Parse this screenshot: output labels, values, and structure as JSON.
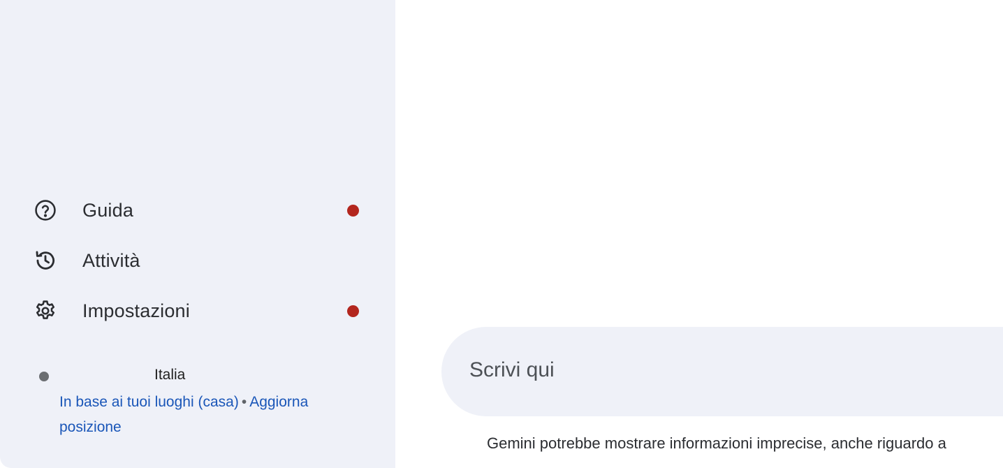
{
  "sidebar": {
    "items": [
      {
        "label": "Guida",
        "icon": "help-circle-icon",
        "has_notification": true
      },
      {
        "label": "Attività",
        "icon": "history-icon",
        "has_notification": false
      },
      {
        "label": "Impostazioni",
        "icon": "gear-icon",
        "has_notification": true
      }
    ],
    "location": {
      "country": "Italia",
      "source_link": "In base ai tuoi luoghi (casa)",
      "separator": "•",
      "update_link": "Aggiorna posizione"
    }
  },
  "main": {
    "input": {
      "placeholder": "Scrivi qui"
    },
    "disclaimer": "Gemini potrebbe mostrare informazioni imprecise, anche riguardo a"
  },
  "colors": {
    "sidebar_bg": "#eff1f8",
    "notification_dot": "#b3261e",
    "link": "#1a56b8",
    "input_bg": "#eff1f8"
  }
}
